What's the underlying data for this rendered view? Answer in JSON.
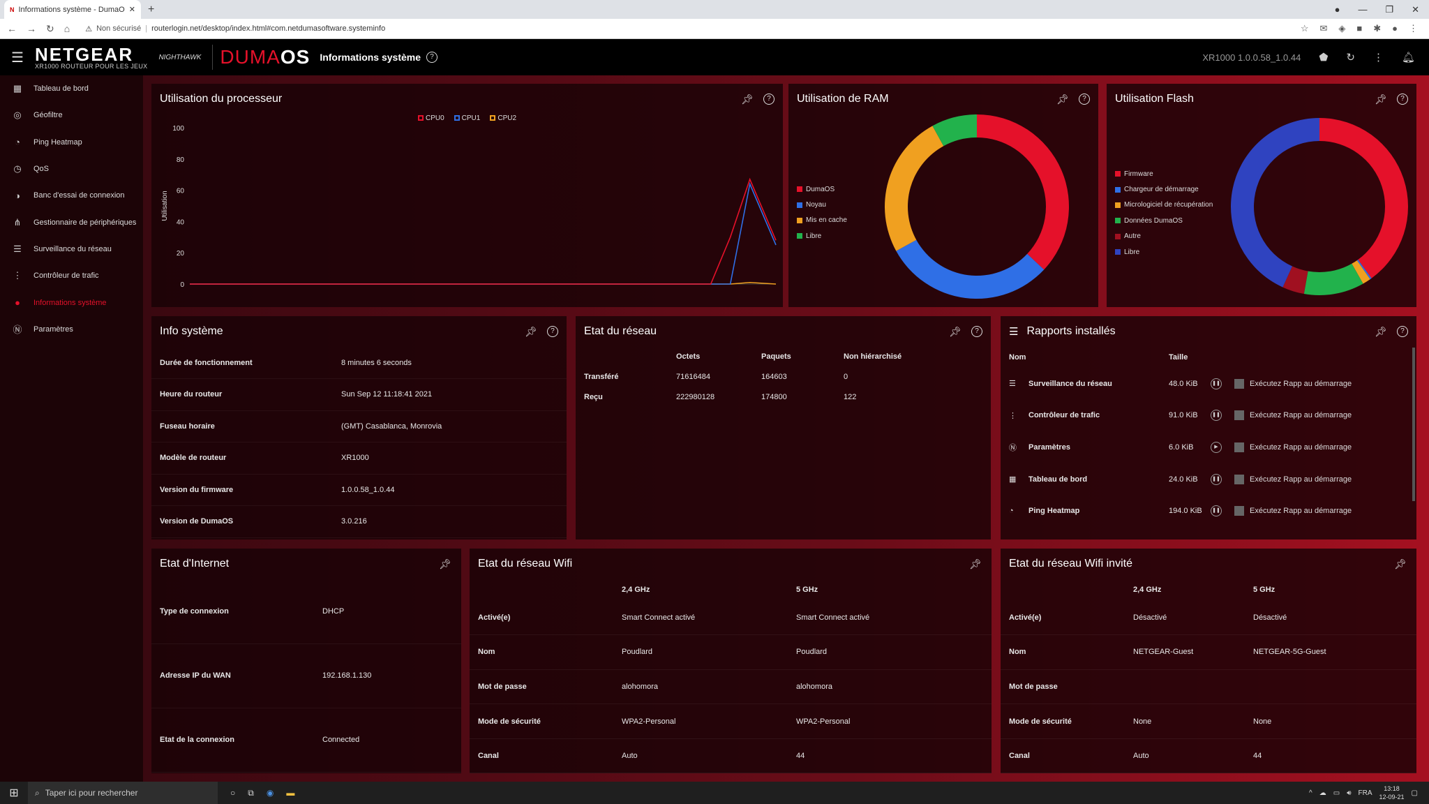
{
  "browser": {
    "tab_favicon": "N",
    "tab_title": "Informations système - DumaOS",
    "tab_close": "✕",
    "new_tab": "+",
    "security_label": "Non sécurisé",
    "url": "routerlogin.net/desktop/index.html#com.netdumasoftware.systeminfo"
  },
  "app": {
    "brand": "NETGEAR",
    "brand_sub": "XR1000 ROUTEUR POUR LES JEUX",
    "nighthawk": "NIGHTHAWK",
    "duma": "DUMA",
    "os": "OS",
    "page_title": "Informations système",
    "firmware": "XR1000 1.0.0.58_1.0.44"
  },
  "sidebar": {
    "items": [
      {
        "label": "Tableau de bord",
        "icon": "dashboard-icon"
      },
      {
        "label": "Géofiltre",
        "icon": "geofilter-icon"
      },
      {
        "label": "Ping Heatmap",
        "icon": "ping-heatmap-icon"
      },
      {
        "label": "QoS",
        "icon": "qos-icon"
      },
      {
        "label": "Banc d'essai de connexion",
        "icon": "benchmark-icon"
      },
      {
        "label": "Gestionnaire de périphériques",
        "icon": "device-manager-icon"
      },
      {
        "label": "Surveillance du réseau",
        "icon": "network-monitor-icon"
      },
      {
        "label": "Contrôleur de trafic",
        "icon": "traffic-controller-icon"
      },
      {
        "label": "Informations système",
        "icon": "system-info-icon",
        "active": true
      },
      {
        "label": "Paramètres",
        "icon": "settings-icon"
      }
    ]
  },
  "cpu": {
    "title": "Utilisation du processeur",
    "ylabel": "Utilisation",
    "legend": [
      "CPU0",
      "CPU1",
      "CPU2"
    ],
    "colors": [
      "#e5112a",
      "#2f6fe6",
      "#f0a020"
    ]
  },
  "chart_data": [
    {
      "type": "line",
      "title": "Utilisation du processeur",
      "ylabel": "Utilisation",
      "ylim": [
        0,
        100
      ],
      "yticks": [
        0,
        20,
        40,
        60,
        80,
        100
      ],
      "x": [
        0,
        10,
        20,
        30,
        40,
        50,
        60,
        70,
        80,
        83,
        86,
        90
      ],
      "series": [
        {
          "name": "CPU0",
          "color": "#e5112a",
          "values": [
            0,
            0,
            0,
            0,
            0,
            0,
            0,
            0,
            0,
            30,
            67,
            28
          ]
        },
        {
          "name": "CPU1",
          "color": "#2f6fe6",
          "values": [
            0,
            0,
            0,
            0,
            0,
            0,
            0,
            0,
            0,
            0,
            64,
            25
          ]
        },
        {
          "name": "CPU2",
          "color": "#f0a020",
          "values": [
            0,
            0,
            0,
            0,
            0,
            0,
            0,
            0,
            0,
            0,
            1,
            0
          ]
        }
      ],
      "grid": false,
      "legend_position": "top"
    },
    {
      "type": "pie",
      "title": "Utilisation de RAM",
      "labels": [
        "DumaOS",
        "Noyau",
        "Mis en cache",
        "Libre"
      ],
      "colors": [
        "#e5112a",
        "#2f6fe6",
        "#f0a020",
        "#22b24c"
      ],
      "values": [
        37,
        30,
        25,
        8
      ],
      "donut": true,
      "legend_position": "left"
    },
    {
      "type": "pie",
      "title": "Utilisation Flash",
      "labels": [
        "Firmware",
        "Chargeur de démarrage",
        "Micrologiciel de récupération",
        "Données DumaOS",
        "Autre",
        "Libre"
      ],
      "colors": [
        "#e5112a",
        "#2f6fe6",
        "#f0a020",
        "#22b24c",
        "#a01020",
        "#2f43c0"
      ],
      "values": [
        40,
        0.3,
        1.5,
        11,
        4,
        43.2
      ],
      "donut": true,
      "legend_position": "left"
    }
  ],
  "ram": {
    "title": "Utilisation de RAM",
    "legend": [
      "DumaOS",
      "Noyau",
      "Mis en cache",
      "Libre"
    ]
  },
  "flash": {
    "title": "Utilisation Flash",
    "legend": [
      "Firmware",
      "Chargeur de démarrage",
      "Micrologiciel de récupération",
      "Données DumaOS",
      "Autre",
      "Libre"
    ]
  },
  "sysinfo": {
    "title": "Info système",
    "rows": [
      {
        "k": "Durée de fonctionnement",
        "v": "8 minutes 6 seconds"
      },
      {
        "k": "Heure du routeur",
        "v": "Sun Sep 12 11:18:41 2021"
      },
      {
        "k": "Fuseau horaire",
        "v": "(GMT) Casablanca, Monrovia"
      },
      {
        "k": "Modèle de routeur",
        "v": "XR1000"
      },
      {
        "k": "Version du firmware",
        "v": "1.0.0.58_1.0.44"
      },
      {
        "k": "Version de DumaOS",
        "v": "3.0.216"
      }
    ]
  },
  "netstate": {
    "title": "Etat du réseau",
    "headers": [
      "",
      "Octets",
      "Paquets",
      "Non hiérarchisé"
    ],
    "rows": [
      [
        "Transféré",
        "71616484",
        "164603",
        "0"
      ],
      [
        "Reçu",
        "222980128",
        "174800",
        "122"
      ]
    ]
  },
  "reports": {
    "title": "Rapports installés",
    "col_name": "Nom",
    "col_size": "Taille",
    "run_label": "Exécutez Rapp au démarrage",
    "rows": [
      {
        "name": "Surveillance du réseau",
        "size": "48.0 KiB",
        "icon": "network-monitor-icon",
        "state": "pause"
      },
      {
        "name": "Contrôleur de trafic",
        "size": "91.0 KiB",
        "icon": "traffic-controller-icon",
        "state": "pause"
      },
      {
        "name": "Paramètres",
        "size": "6.0 KiB",
        "icon": "settings-icon",
        "state": "play"
      },
      {
        "name": "Tableau de bord",
        "size": "24.0 KiB",
        "icon": "dashboard-icon",
        "state": "pause"
      },
      {
        "name": "Ping Heatmap",
        "size": "194.0 KiB",
        "icon": "ping-heatmap-icon",
        "state": "pause"
      }
    ]
  },
  "internet": {
    "title": "Etat d'Internet",
    "rows": [
      {
        "k": "Type de connexion",
        "v": "DHCP"
      },
      {
        "k": "Adresse IP du WAN",
        "v": "192.168.1.130"
      },
      {
        "k": "Etat de la connexion",
        "v": "Connected"
      }
    ]
  },
  "wifi": {
    "title": "Etat du réseau Wifi",
    "headers": [
      "",
      "2,4 GHz",
      "5 GHz"
    ],
    "rows": [
      [
        "Activé(e)",
        "Smart Connect activé",
        "Smart Connect activé"
      ],
      [
        "Nom",
        "Poudlard",
        "Poudlard"
      ],
      [
        "Mot de passe",
        "alohomora",
        "alohomora"
      ],
      [
        "Mode de sécurité",
        "WPA2-Personal",
        "WPA2-Personal"
      ],
      [
        "Canal",
        "Auto",
        "44"
      ]
    ]
  },
  "guest": {
    "title": "Etat du réseau Wifi invité",
    "headers": [
      "",
      "2,4 GHz",
      "5 GHz"
    ],
    "rows": [
      [
        "Activé(e)",
        "Désactivé",
        "Désactivé"
      ],
      [
        "Nom",
        "NETGEAR-Guest",
        "NETGEAR-5G-Guest"
      ],
      [
        "Mot de passe",
        "",
        ""
      ],
      [
        "Mode de sécurité",
        "None",
        "None"
      ],
      [
        "Canal",
        "Auto",
        "44"
      ]
    ]
  },
  "taskbar": {
    "search_placeholder": "Taper ici pour rechercher",
    "lang": "FRA",
    "time": "13:18",
    "date": "12-09-21"
  }
}
